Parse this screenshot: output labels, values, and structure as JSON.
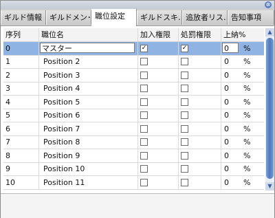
{
  "window": {
    "close_symbol": "⊗"
  },
  "tabs": [
    {
      "label": "ギルド情報",
      "active": false
    },
    {
      "label": "ギルドメン･…",
      "active": false
    },
    {
      "label": "職位設定",
      "active": true
    },
    {
      "label": "ギルドスキ…",
      "active": false
    },
    {
      "label": "追放者リス…",
      "active": false
    },
    {
      "label": "告知事項",
      "active": false
    }
  ],
  "table": {
    "headers": {
      "seq": "序列",
      "name": "職位名",
      "join": "加入権限",
      "punish": "処罰権限",
      "rate": "上納%"
    },
    "rows": [
      {
        "seq": "0",
        "name": "マスター",
        "join": true,
        "punish": true,
        "rate": "0",
        "pct": "%",
        "selected": true
      },
      {
        "seq": "1",
        "name": "Position 2",
        "join": false,
        "punish": false,
        "rate": "0",
        "pct": "%"
      },
      {
        "seq": "2",
        "name": "Position 3",
        "join": false,
        "punish": false,
        "rate": "0",
        "pct": "%"
      },
      {
        "seq": "3",
        "name": "Position 4",
        "join": false,
        "punish": false,
        "rate": "0",
        "pct": "%"
      },
      {
        "seq": "4",
        "name": "Position 5",
        "join": false,
        "punish": false,
        "rate": "0",
        "pct": "%"
      },
      {
        "seq": "5",
        "name": "Position 6",
        "join": false,
        "punish": false,
        "rate": "0",
        "pct": "%"
      },
      {
        "seq": "6",
        "name": "Position 7",
        "join": false,
        "punish": false,
        "rate": "0",
        "pct": "%"
      },
      {
        "seq": "7",
        "name": "Position 8",
        "join": false,
        "punish": false,
        "rate": "0",
        "pct": "%"
      },
      {
        "seq": "8",
        "name": "Position 9",
        "join": false,
        "punish": false,
        "rate": "0",
        "pct": "%"
      },
      {
        "seq": "9",
        "name": "Position 10",
        "join": false,
        "punish": false,
        "rate": "0",
        "pct": "%"
      },
      {
        "seq": "10",
        "name": "Position 11",
        "join": false,
        "punish": false,
        "rate": "0",
        "pct": "%"
      }
    ]
  },
  "scrollbar": {
    "up_symbol": "▲",
    "down_symbol": "▼"
  },
  "colors": {
    "selected_row": "#8fb3e3",
    "scroll_thumb": "#4f78bd"
  }
}
